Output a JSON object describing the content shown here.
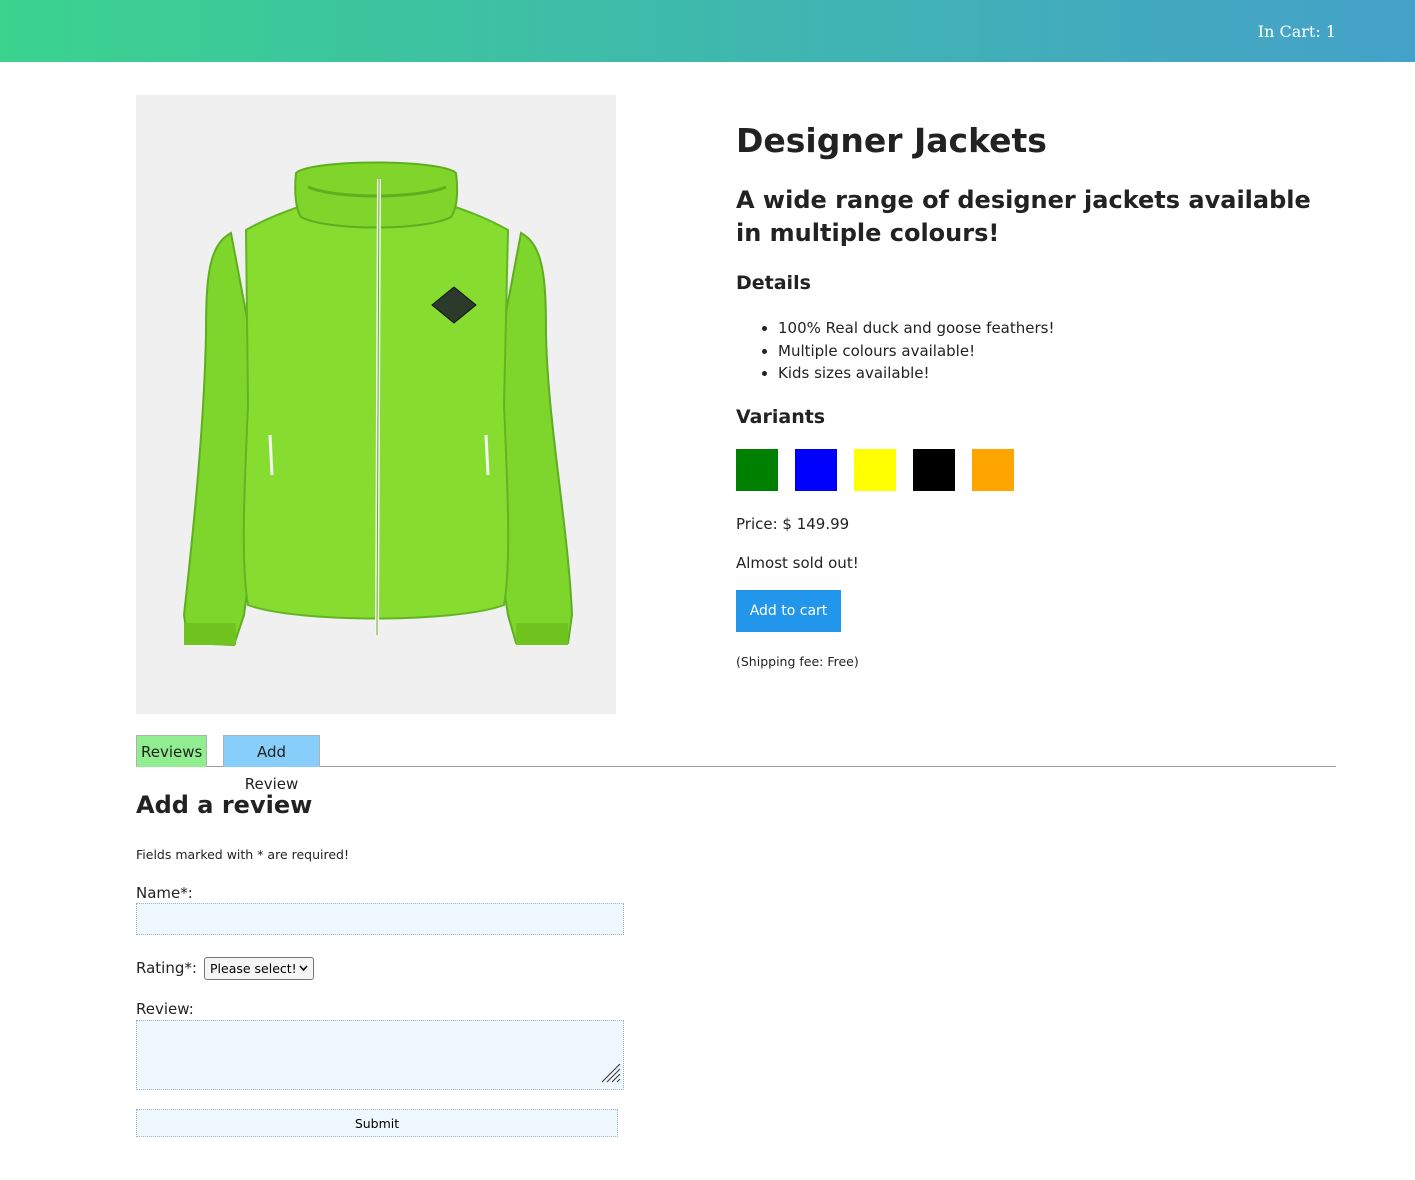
{
  "navbar": {
    "cart_text": "In Cart: 1",
    "gradient": [
      "#3bd38e",
      "#45a1c9"
    ]
  },
  "product": {
    "image": {
      "icon": "green-jacket-image",
      "color": "#7fd82e"
    },
    "title": "Designer Jackets",
    "subtitle": "A wide range of designer jackets available in multiple colours!",
    "details_heading": "Details",
    "details": [
      "100% Real duck and goose feathers!",
      "Multiple colours available!",
      "Kids sizes available!"
    ],
    "variants_heading": "Variants",
    "variants": [
      {
        "color": "#008000"
      },
      {
        "color": "#0000ff"
      },
      {
        "color": "#ffff00"
      },
      {
        "color": "#000000"
      },
      {
        "color": "#ffa500"
      }
    ],
    "price_text": "Price: $ 149.99",
    "stock_text": "Almost sold out!",
    "add_to_cart_label": "Add to cart",
    "add_to_cart_color": "#2196eb",
    "shipping_text": "(Shipping fee: Free)"
  },
  "tabs": [
    {
      "label": "Reviews",
      "color": "#90ee90"
    },
    {
      "label": "Add Review",
      "color": "#87cefa"
    }
  ],
  "review_form": {
    "title": "Add a review",
    "required_note": "Fields marked with * are required!",
    "name_label": "Name*:",
    "name_value": "",
    "rating_label": "Rating*:",
    "rating_selected": "Please select!",
    "review_label": "Review:",
    "review_value": "",
    "submit_label": "Submit"
  }
}
